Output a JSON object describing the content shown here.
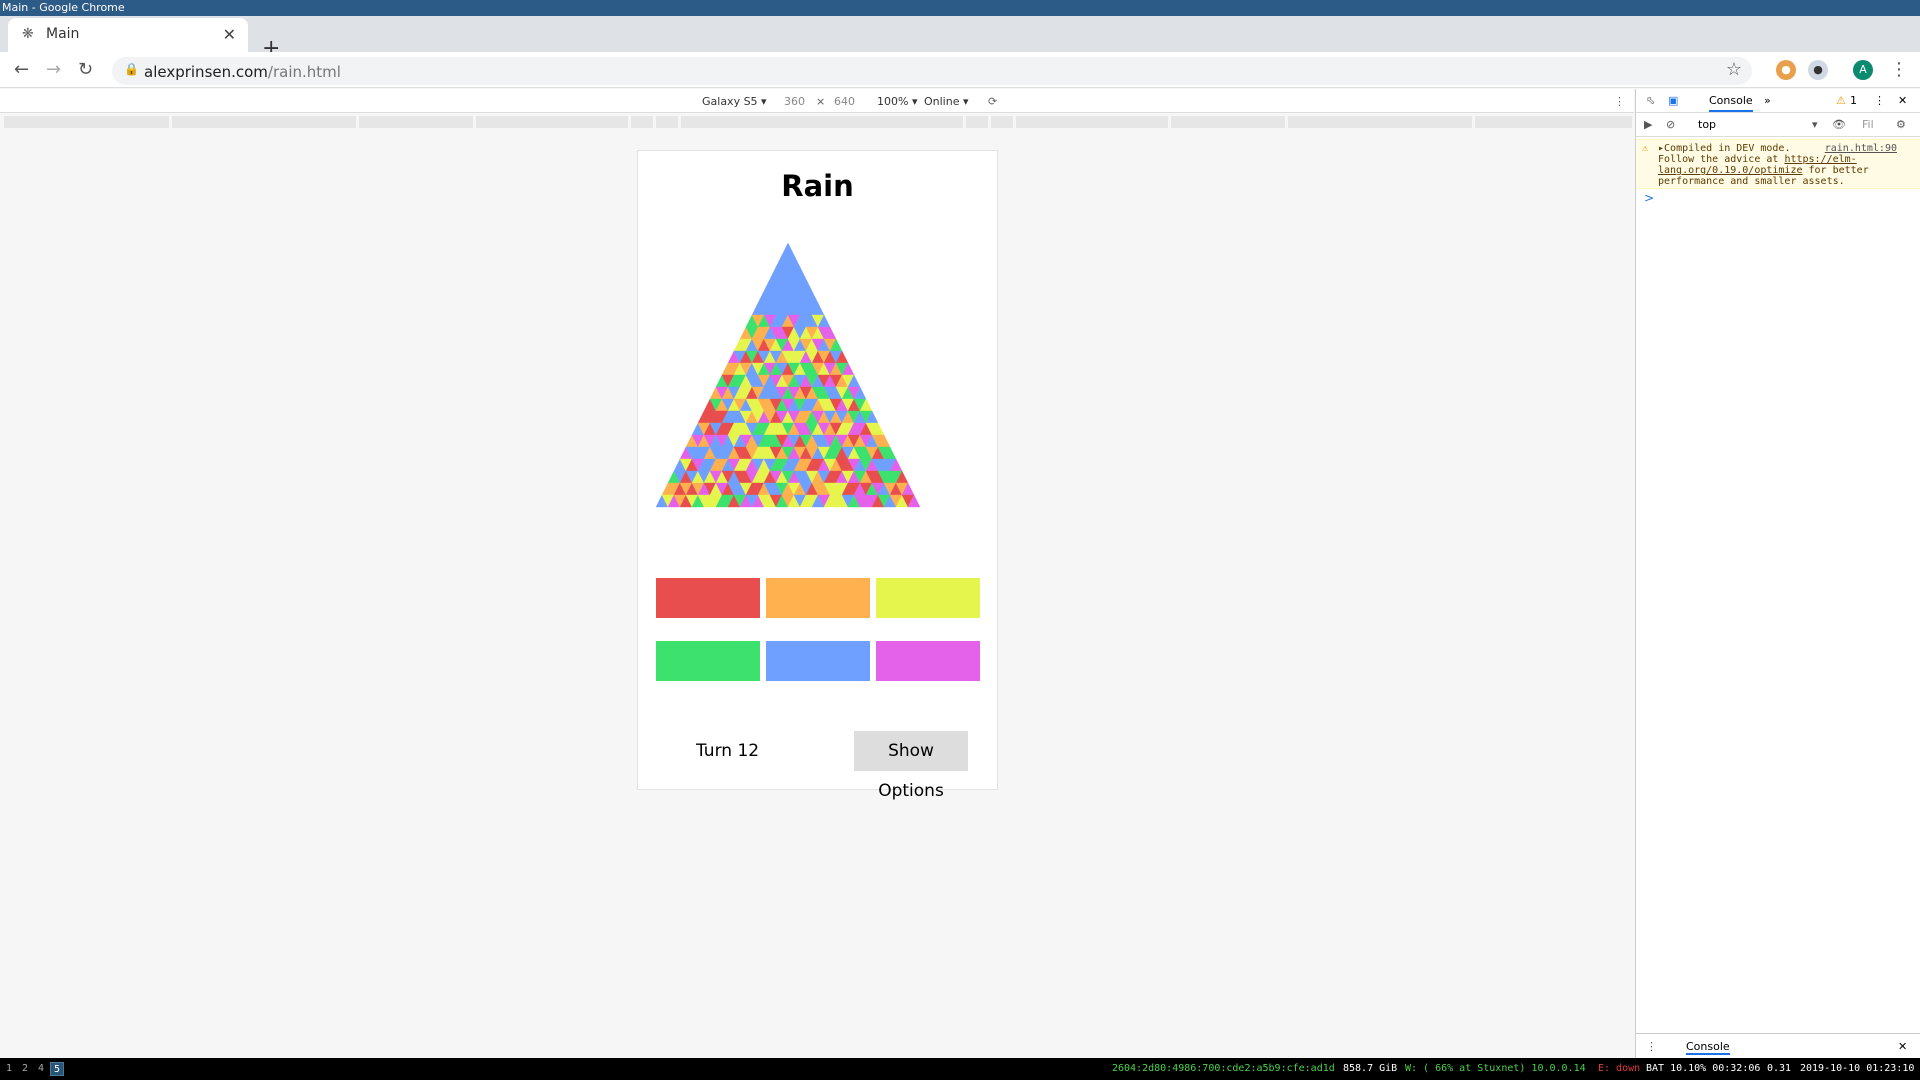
{
  "window": {
    "title": "Main - Google Chrome"
  },
  "tab": {
    "title": "Main",
    "new_tab": "+"
  },
  "address": {
    "domain": "alexprinsen.com",
    "path": "/rain.html"
  },
  "profile": {
    "initial": "A"
  },
  "device_toolbar": {
    "device": "Galaxy S5 ▾",
    "width": "360",
    "times": "×",
    "height": "640",
    "zoom": "100% ▾",
    "network": "Online ▾"
  },
  "game": {
    "title": "Rain",
    "turn_label": "Turn 12",
    "options_label": "Show Options",
    "palette": [
      "#e94e4e",
      "#ffb04f",
      "#e6f54e",
      "#3ce26d",
      "#6fa0ff",
      "#e462ea"
    ],
    "top_color_rows": 6,
    "total_rows": 22
  },
  "devtools": {
    "tab_console": "Console",
    "more": "»",
    "warn_count": "1",
    "context": "top",
    "filter": "Fil",
    "warning": {
      "line1": "Compiled in DEV mode.",
      "source": "rain.html:90",
      "line2": "Follow the advice at ",
      "link": "https://elm-lang.org/0.19.0/optimize",
      "line3": " for better performance and smaller assets."
    },
    "prompt": ">",
    "drawer_label": "Console"
  },
  "status": {
    "workspaces": [
      "1",
      "2",
      "4",
      "5"
    ],
    "ipv6": "2604:2d80:4986:700:cde2:a5b9:cfe:ad1d",
    "disk": "858.7 GiB",
    "wifi": "W: ( 66% at Stuxnet) 10.0.0.14",
    "eth": "E: down",
    "battery": "BAT 10.10% 00:32:06",
    "load": "0.31",
    "datetime": "2019-10-10 01:23:10"
  }
}
